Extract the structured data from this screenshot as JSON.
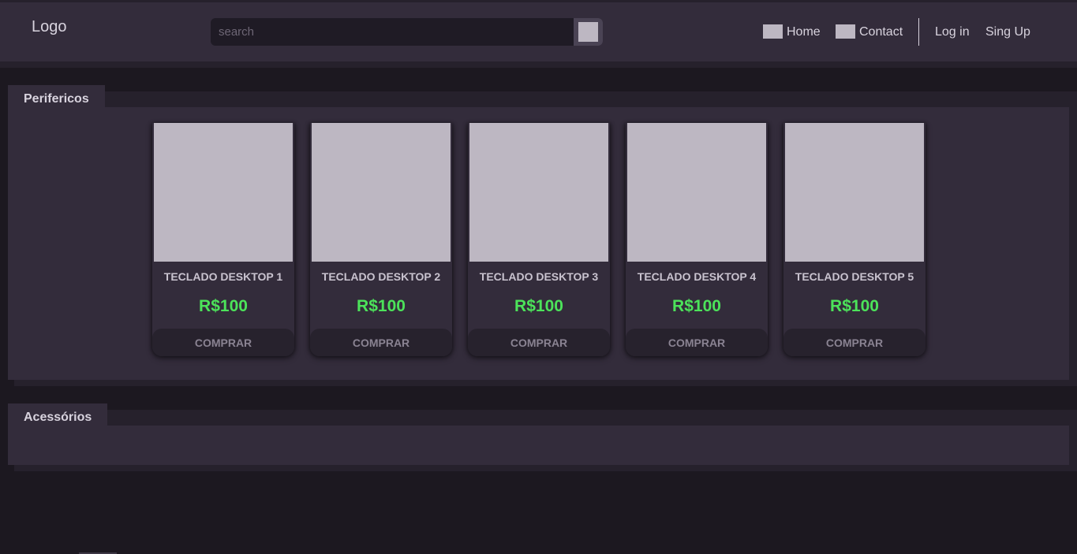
{
  "header": {
    "logo": "Logo",
    "search": {
      "placeholder": "search",
      "value": ""
    },
    "nav": {
      "home": "Home",
      "contact": "Contact",
      "login": "Log in",
      "signup": "Sing Up"
    }
  },
  "sections": [
    {
      "title": "Perifericos",
      "products": [
        {
          "name": "TECLADO DESKTOP 1",
          "price": "R$100",
          "button": "COMPRAR"
        },
        {
          "name": "TECLADO DESKTOP 2",
          "price": "R$100",
          "button": "COMPRAR"
        },
        {
          "name": "TECLADO DESKTOP 3",
          "price": "R$100",
          "button": "COMPRAR"
        },
        {
          "name": "TECLADO DESKTOP 4",
          "price": "R$100",
          "button": "COMPRAR"
        },
        {
          "name": "TECLADO DESKTOP 5",
          "price": "R$100",
          "button": "COMPRAR"
        }
      ]
    },
    {
      "title": "Acessórios",
      "products": []
    }
  ],
  "colors": {
    "background": "#1c1820",
    "panel": "#332c3b",
    "price": "#4ce35a",
    "placeholder_image": "#bdb7c2"
  }
}
